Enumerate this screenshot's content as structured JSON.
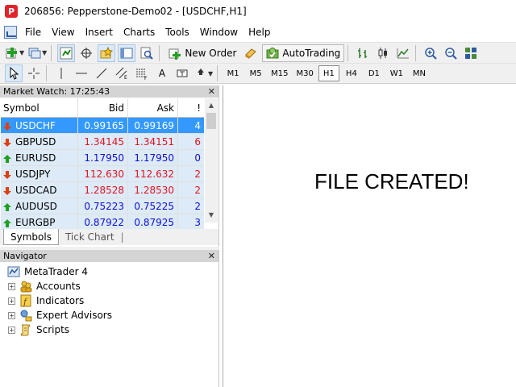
{
  "window": {
    "title": "206856: Pepperstone-Demo02 - [USDCHF,H1]"
  },
  "menu": [
    "File",
    "View",
    "Insert",
    "Charts",
    "Tools",
    "Window",
    "Help"
  ],
  "toolbar": {
    "new_order_label": "New Order",
    "autotrading_label": "AutoTrading",
    "timeframes": [
      "M1",
      "M5",
      "M15",
      "M30",
      "H1",
      "H4",
      "D1",
      "W1",
      "MN"
    ],
    "active_timeframe": "H1",
    "text_tool_label": "A"
  },
  "market_watch": {
    "title": "Market Watch: 17:25:43",
    "columns": {
      "symbol": "Symbol",
      "bid": "Bid",
      "ask": "Ask",
      "spread": "!"
    },
    "rows": [
      {
        "symbol": "USDCHF",
        "bid": "0.99165",
        "ask": "0.99169",
        "spread": "4",
        "direction": "down",
        "bid_color": "blue",
        "ask_color": "blue",
        "selected": true
      },
      {
        "symbol": "GBPUSD",
        "bid": "1.34145",
        "ask": "1.34151",
        "spread": "6",
        "direction": "down",
        "bid_color": "red",
        "ask_color": "red",
        "selected": false
      },
      {
        "symbol": "EURUSD",
        "bid": "1.17950",
        "ask": "1.17950",
        "spread": "0",
        "direction": "up",
        "bid_color": "blue",
        "ask_color": "blue",
        "selected": false
      },
      {
        "symbol": "USDJPY",
        "bid": "112.630",
        "ask": "112.632",
        "spread": "2",
        "direction": "down",
        "bid_color": "red",
        "ask_color": "red",
        "selected": false
      },
      {
        "symbol": "USDCAD",
        "bid": "1.28528",
        "ask": "1.28530",
        "spread": "2",
        "direction": "down",
        "bid_color": "red",
        "ask_color": "red",
        "selected": false
      },
      {
        "symbol": "AUDUSD",
        "bid": "0.75223",
        "ask": "0.75225",
        "spread": "2",
        "direction": "up",
        "bid_color": "blue",
        "ask_color": "blue",
        "selected": false
      },
      {
        "symbol": "EURGBP",
        "bid": "0.87922",
        "ask": "0.87925",
        "spread": "3",
        "direction": "up",
        "bid_color": "blue",
        "ask_color": "blue",
        "selected": false
      }
    ],
    "tabs": [
      "Symbols",
      "Tick Chart"
    ],
    "active_tab": "Symbols"
  },
  "navigator": {
    "title": "Navigator",
    "root": "MetaTrader 4",
    "items": [
      {
        "label": "Accounts",
        "icon": "accounts-icon"
      },
      {
        "label": "Indicators",
        "icon": "indicators-icon"
      },
      {
        "label": "Expert Advisors",
        "icon": "expert-advisors-icon"
      },
      {
        "label": "Scripts",
        "icon": "scripts-icon"
      }
    ]
  },
  "chart": {
    "message": "FILE CREATED!"
  },
  "colors": {
    "selected_row": "#3399ff",
    "row_background": "#ddeaf7",
    "price_down": "#e0141e",
    "price_up": "#1010d0",
    "arrow_up": "#1ea01e",
    "arrow_down": "#e04010",
    "panel_header": "#d4d4d4",
    "toolbar_bg": "#f0f0f0"
  }
}
